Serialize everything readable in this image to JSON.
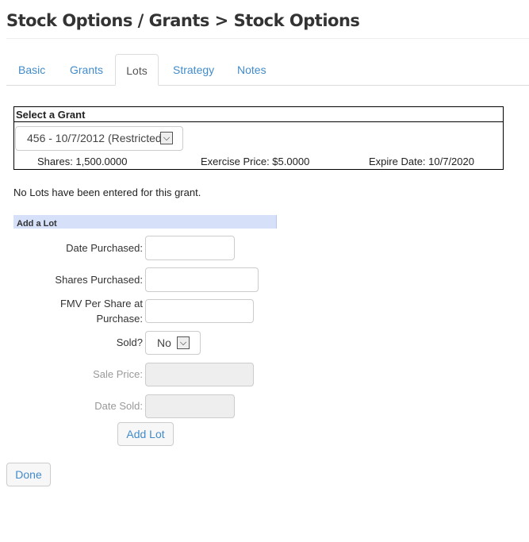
{
  "header": {
    "title": "Stock Options / Grants > Stock Options"
  },
  "tabs": [
    {
      "label": "Basic"
    },
    {
      "label": "Grants"
    },
    {
      "label": "Lots",
      "active": true
    },
    {
      "label": "Strategy"
    },
    {
      "label": "Notes"
    }
  ],
  "grant": {
    "heading": "Select a Grant",
    "selected": "456 - 10/7/2012 (Restricted)",
    "shares": "Shares: 1,500.0000",
    "exercise_price": "Exercise Price: $5.0000",
    "expire_date": "Expire Date: 10/7/2020"
  },
  "message": "No Lots have been entered for this grant.",
  "add_lot": {
    "heading": "Add a Lot",
    "date_purchased_label": "Date Purchased:",
    "shares_purchased_label": "Shares Purchased:",
    "fmv_label_1": "FMV Per Share at",
    "fmv_label_2": "Purchase:",
    "sold_label": "Sold?",
    "sold_value": "No",
    "sale_price_label": "Sale Price:",
    "date_sold_label": "Date Sold:",
    "submit": "Add Lot"
  },
  "done": "Done",
  "colors": {
    "link": "#428bca",
    "section_bar": "#d6e0f8"
  }
}
